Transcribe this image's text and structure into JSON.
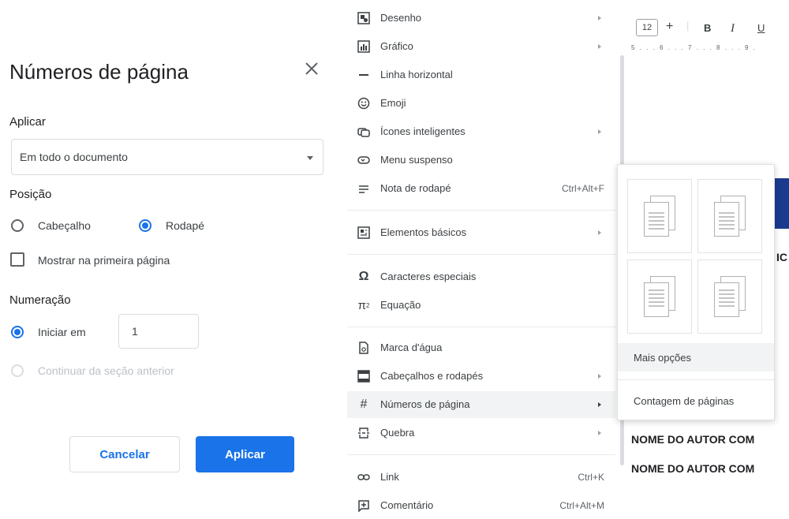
{
  "dialog": {
    "title": "Números de página",
    "apply_section": "Aplicar",
    "apply_select": "Em todo o documento",
    "position_section": "Posição",
    "position_header": "Cabeçalho",
    "position_footer": "Rodapé",
    "position_selected": "Rodapé",
    "show_first_page": "Mostrar na primeira página",
    "show_first_page_checked": false,
    "numbering_section": "Numeração",
    "start_at": "Iniciar em",
    "start_value": "1",
    "continue_previous": "Continuar da seção anterior",
    "cancel": "Cancelar",
    "apply": "Aplicar"
  },
  "menu": {
    "items": [
      {
        "label": "Desenho",
        "icon": "drawing-icon",
        "submenu": true
      },
      {
        "label": "Gráfico",
        "icon": "chart-icon",
        "submenu": true
      },
      {
        "label": "Linha horizontal",
        "icon": "horizontal-line-icon"
      },
      {
        "label": "Emoji",
        "icon": "emoji-icon"
      },
      {
        "label": "Ícones inteligentes",
        "icon": "smart-chips-icon",
        "submenu": true
      },
      {
        "label": "Menu suspenso",
        "icon": "dropdown-icon"
      },
      {
        "label": "Nota de rodapé",
        "icon": "footnote-icon",
        "shortcut": "Ctrl+Alt+F"
      },
      {
        "label": "Elementos básicos",
        "icon": "building-blocks-icon",
        "submenu": true
      },
      {
        "label": "Caracteres especiais",
        "icon": "omega-icon"
      },
      {
        "label": "Equação",
        "icon": "pi-icon"
      },
      {
        "label": "Marca d'água",
        "icon": "watermark-icon"
      },
      {
        "label": "Cabeçalhos e rodapés",
        "icon": "header-footer-icon",
        "submenu": true
      },
      {
        "label": "Números de página",
        "icon": "hash-icon",
        "submenu": true,
        "highlighted": true
      },
      {
        "label": "Quebra",
        "icon": "break-icon",
        "submenu": true
      },
      {
        "label": "Link",
        "icon": "link-icon",
        "shortcut": "Ctrl+K"
      },
      {
        "label": "Comentário",
        "icon": "comment-icon",
        "shortcut": "Ctrl+Alt+M"
      }
    ]
  },
  "submenu": {
    "more_options": "Mais opções",
    "page_count": "Contagem de páginas"
  },
  "editor": {
    "font_size": "12",
    "plus": "+",
    "bold": "B",
    "italic": "I",
    "underline": "U",
    "ruler": "5 . . . 6 . . . 7 . . . 8 . . . 9 .",
    "fragment": "IC",
    "author_line_1": "NOME DO AUTOR COM",
    "author_line_2": "NOME DO AUTOR COM"
  },
  "colors": {
    "accent": "#1a73e8",
    "navy_block": "#1a3a8f"
  }
}
